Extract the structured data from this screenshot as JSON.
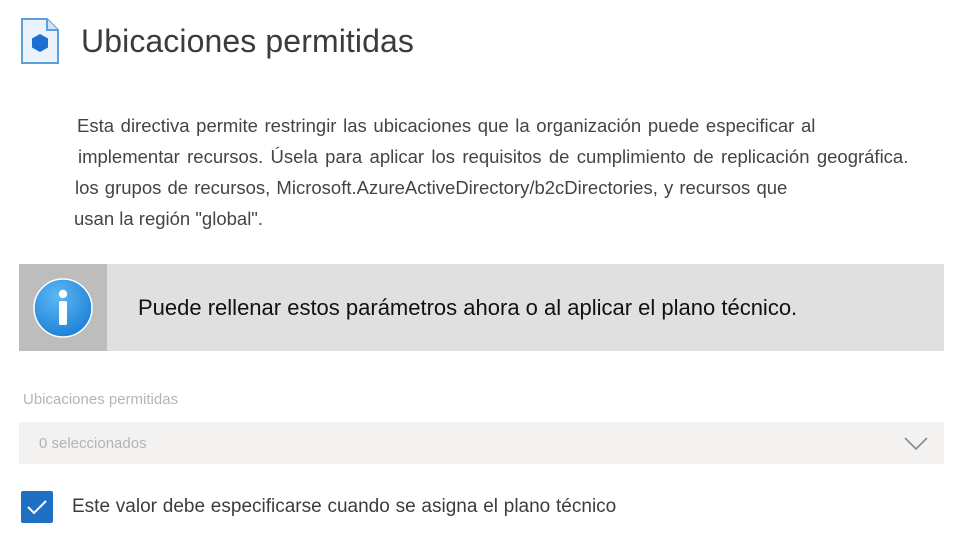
{
  "header": {
    "title": "Ubicaciones permitidas",
    "icon": "policy-document-icon"
  },
  "description": {
    "lines": [
      "Esta directiva permite restringir las ubicaciones que la organización puede especificar al",
      "implementar recursos. Úsela para aplicar los requisitos de cumplimiento de replicación geográfica.",
      "los grupos de recursos, Microsoft.AzureActiveDirectory/b2cDirectories, y recursos que",
      "usan la región \"global\"."
    ]
  },
  "info_banner": {
    "icon": "info-icon",
    "text": "Puede rellenar estos parámetros ahora o al aplicar el plano técnico."
  },
  "allowed_locations": {
    "label": "Ubicaciones permitidas",
    "value": "0 seleccionados",
    "icon": "chevron-down-icon"
  },
  "required_checkbox": {
    "checked": true,
    "label": "Este valor debe especificarse cuando se asigna el plano técnico"
  },
  "colors": {
    "accent": "#1f6fc5",
    "banner_background": "#e0e0e0",
    "banner_icon_background": "#bdbdbd",
    "info_icon": "#2b8fe0",
    "select_background": "#f3f2f1"
  }
}
